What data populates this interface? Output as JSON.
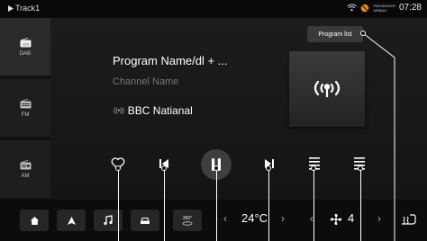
{
  "status_bar": {
    "track_label": "Track1",
    "passenger_label_1": "PASSENGER",
    "passenger_label_2": "AIRBAG",
    "time": "07:28"
  },
  "sidebar": {
    "items": [
      {
        "label": "DAB",
        "icon": "radio-icon"
      },
      {
        "label": "FM",
        "icon": "radio-icon"
      },
      {
        "label": "AM",
        "icon": "radio-icon"
      }
    ]
  },
  "main": {
    "program_name": "Program Name/dl + ...",
    "channel_name": "Channel Name",
    "station_name": "BBC Natianal",
    "program_list_label": "Program list"
  },
  "controls": {
    "icons": [
      "heart-icon",
      "previous-icon",
      "pause-icon",
      "next-icon",
      "list-icon",
      "menu-icon"
    ]
  },
  "bottom_bar": {
    "camera_label": "360°",
    "temperature": "24°C",
    "fan_speed": "4"
  }
}
